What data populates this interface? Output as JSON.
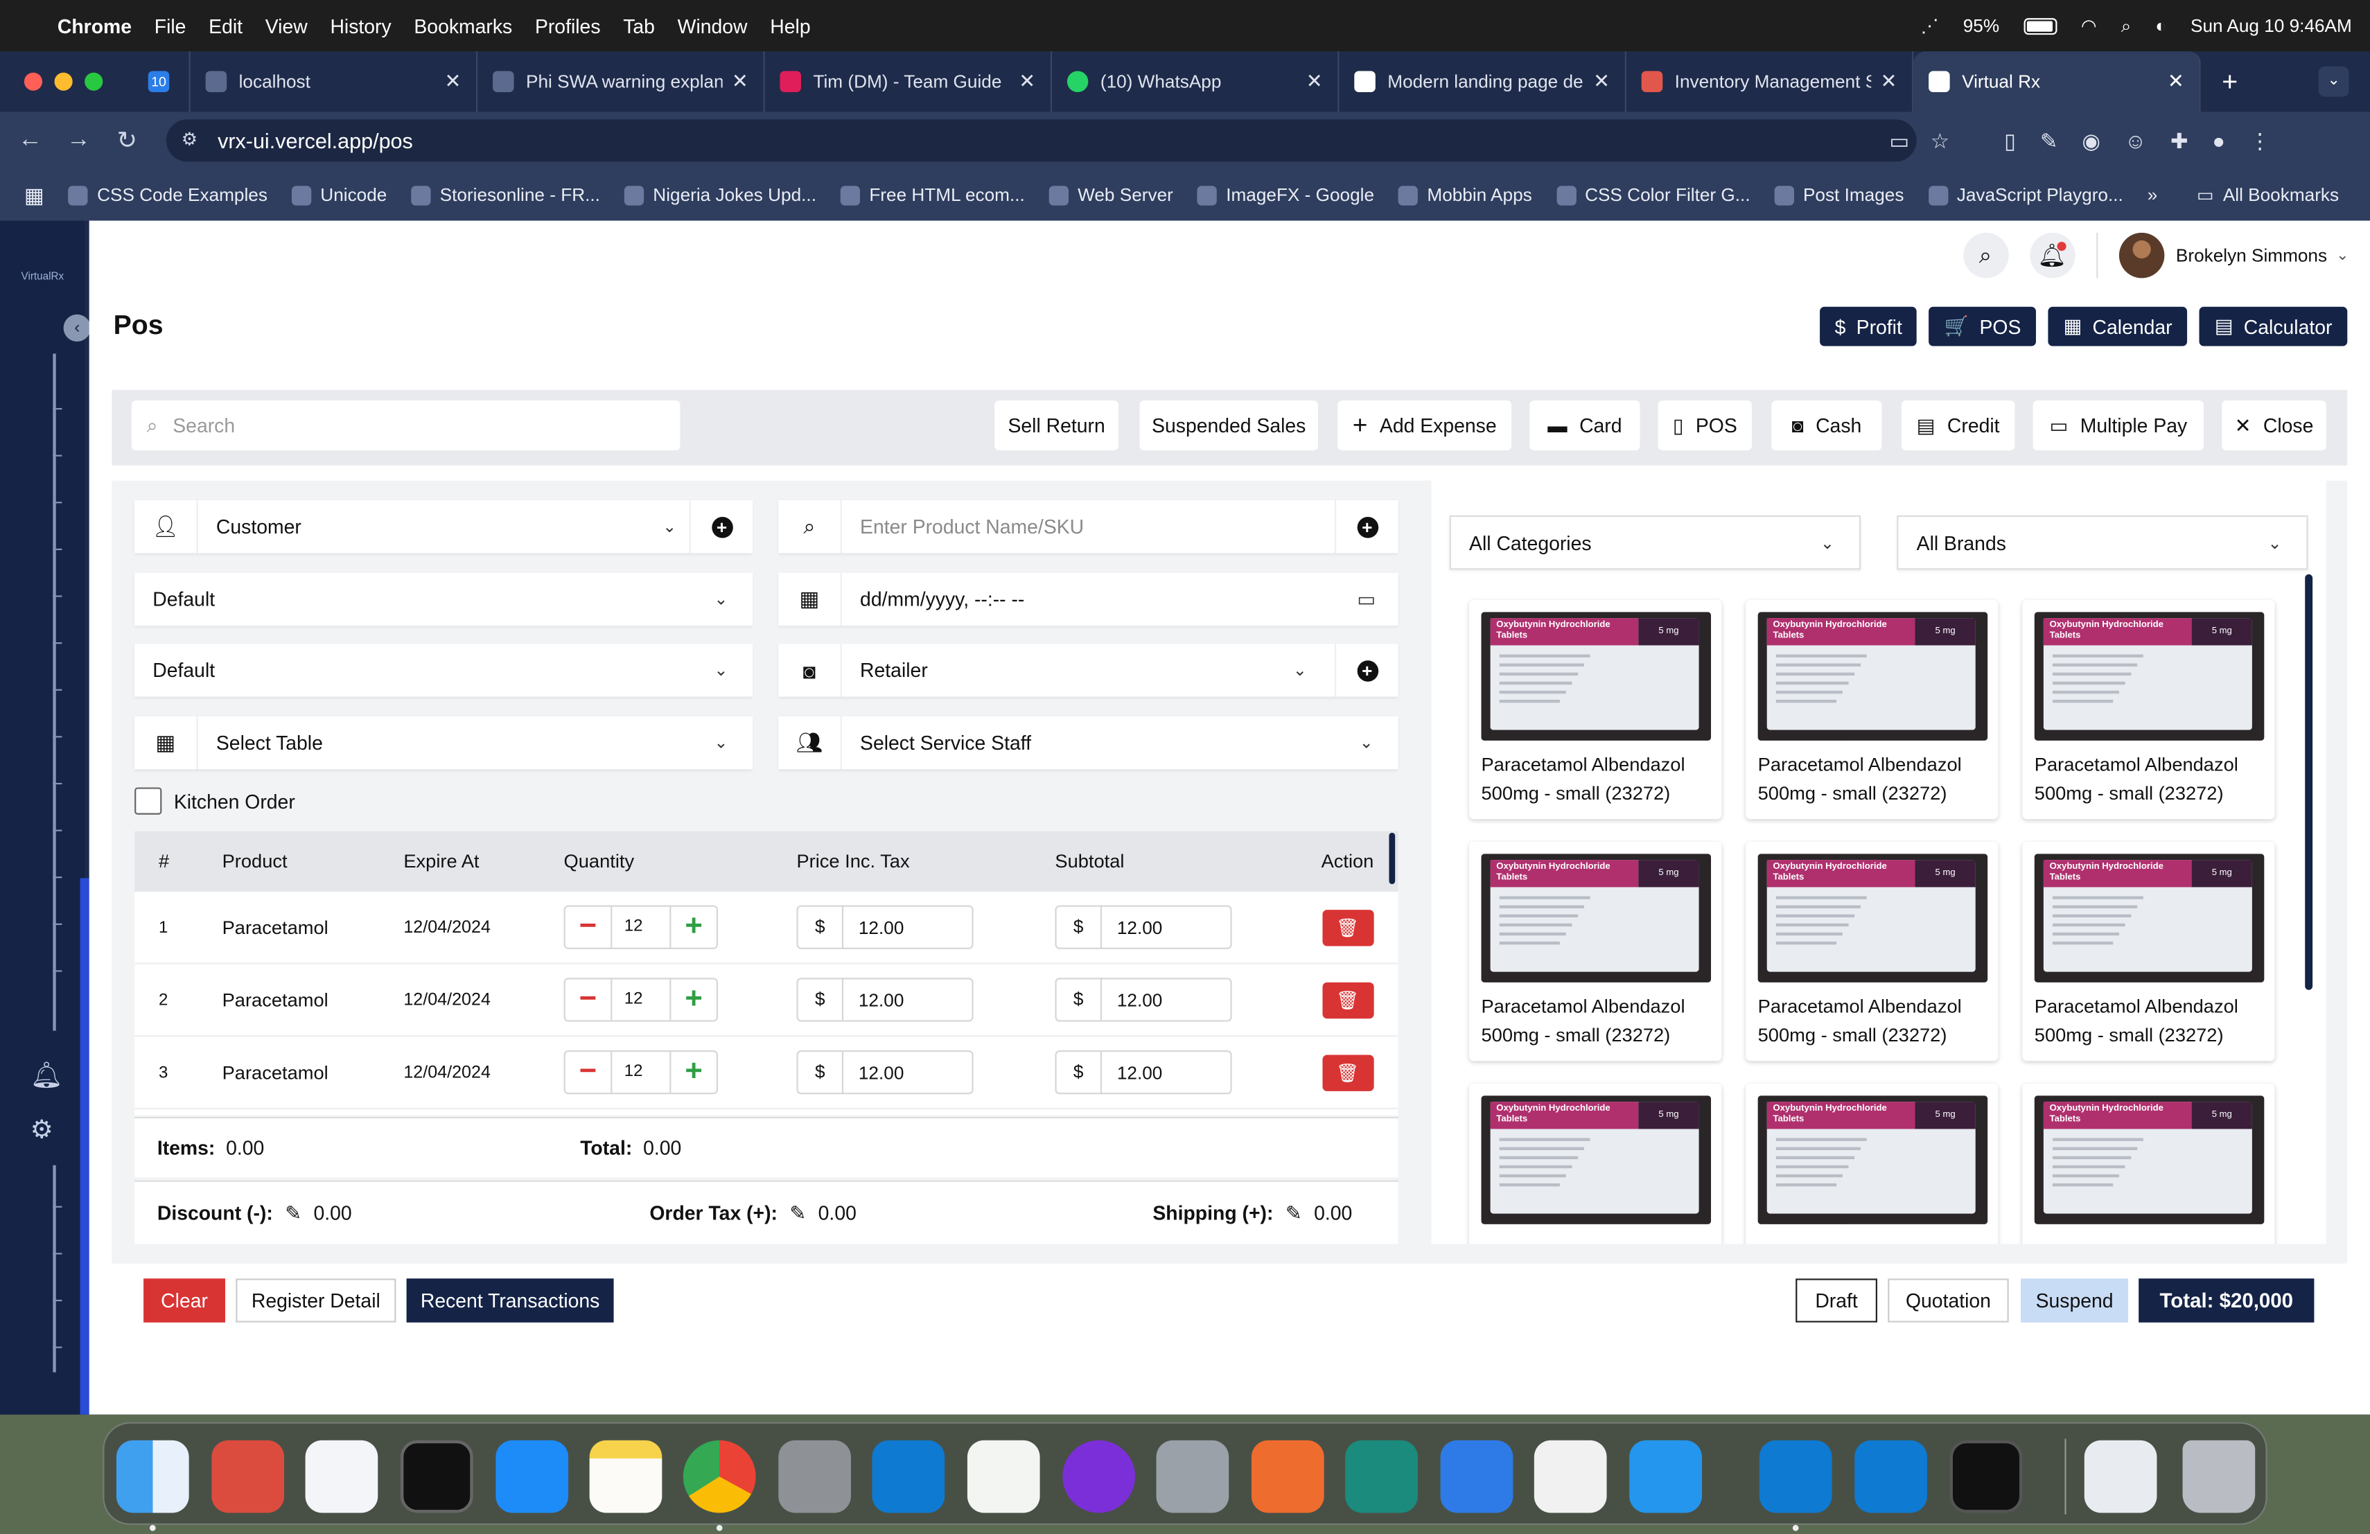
{
  "macos": {
    "app_name": "Chrome",
    "menus": [
      "File",
      "Edit",
      "View",
      "History",
      "Bookmarks",
      "Profiles",
      "Tab",
      "Window",
      "Help"
    ],
    "battery": "95%",
    "battery_level": 0.95,
    "datetime": "Sun Aug 10  9:46AM"
  },
  "browser": {
    "tabs": [
      {
        "title": "localhost",
        "active": false
      },
      {
        "title": "Phi SWA warning explan",
        "active": false
      },
      {
        "title": "Tim (DM) - Team Guide",
        "active": false
      },
      {
        "title": "(10) WhatsApp",
        "active": false
      },
      {
        "title": "Modern landing page de",
        "active": false
      },
      {
        "title": "Inventory Management S",
        "active": false
      },
      {
        "title": "Virtual Rx",
        "active": true
      }
    ],
    "first_tab_badge": "10",
    "url": "vrx-ui.vercel.app/pos",
    "bookmarks": [
      "CSS Code Examples",
      "Unicode",
      "Storiesonline - FR...",
      "Nigeria Jokes Upd...",
      "Free HTML ecom...",
      "Web Server",
      "ImageFX - Google",
      "Mobbin Apps",
      "CSS Color Filter G...",
      "Post Images",
      "JavaScript Playgro..."
    ],
    "bookmarks_overflow": "»",
    "all_bookmarks": "All Bookmarks"
  },
  "sidebar": {
    "logo_text": "VirtualRx"
  },
  "header": {
    "user_name": "Brokelyn Simmons"
  },
  "page": {
    "title": "Pos",
    "quick_buttons": [
      {
        "label": "Profit",
        "icon": "$"
      },
      {
        "label": "POS",
        "icon": "🛒"
      },
      {
        "label": "Calendar",
        "icon": "▦"
      },
      {
        "label": "Calculator",
        "icon": "▤"
      }
    ]
  },
  "actions": {
    "search_placeholder": "Search",
    "buttons": [
      {
        "label": "Sell Return",
        "icon": ""
      },
      {
        "label": "Suspended Sales",
        "icon": ""
      },
      {
        "label": "Add Expense",
        "icon": "+"
      },
      {
        "label": "Card",
        "icon": "▬"
      },
      {
        "label": "POS",
        "icon": "▯"
      },
      {
        "label": "Cash",
        "icon": "◙"
      },
      {
        "label": "Credit",
        "icon": "▤"
      },
      {
        "label": "Multiple Pay",
        "icon": "▭"
      },
      {
        "label": "Close",
        "icon": "✕"
      }
    ]
  },
  "form": {
    "customer": "Customer",
    "default_1": "Default",
    "default_2": "Default",
    "table": "Select Table",
    "product_placeholder": "Enter Product Name/SKU",
    "date_placeholder": "dd/mm/yyyy, --:-- --",
    "retailer": "Retailer",
    "service_staff": "Select Service Staff",
    "kitchen_order": "Kitchen Order"
  },
  "cart": {
    "headers": [
      "#",
      "Product",
      "Expire At",
      "Quantity",
      "Price Inc. Tax",
      "Subtotal",
      "Action"
    ],
    "currency": "$",
    "rows": [
      {
        "num": "1",
        "product": "Paracetamol",
        "expire": "12/04/2024",
        "qty": "12",
        "price": "12.00",
        "subtotal": "12.00"
      },
      {
        "num": "2",
        "product": "Paracetamol",
        "expire": "12/04/2024",
        "qty": "12",
        "price": "12.00",
        "subtotal": "12.00"
      },
      {
        "num": "3",
        "product": "Paracetamol",
        "expire": "12/04/2024",
        "qty": "12",
        "price": "12.00",
        "subtotal": "12.00"
      }
    ],
    "items_label": "Items:",
    "items_value": "0.00",
    "total_label": "Total:",
    "total_value": "0.00",
    "discount_label": "Discount (-):",
    "discount_value": "0.00",
    "order_tax_label": "Order Tax (+):",
    "order_tax_value": "0.00",
    "shipping_label": "Shipping (+):",
    "shipping_value": "0.00"
  },
  "products": {
    "category_filter": "All Categories",
    "brand_filter": "All Brands",
    "package_label": "Oxybutynin Hydrochloride Tablets",
    "package_strength": "5 mg",
    "items": [
      {
        "name": "Paracetamol Albendazol 500mg - small (23272)"
      },
      {
        "name": "Paracetamol Albendazol 500mg - small (23272)"
      },
      {
        "name": "Paracetamol Albendazol 500mg - small (23272)"
      },
      {
        "name": "Paracetamol Albendazol 500mg - small (23272)"
      },
      {
        "name": "Paracetamol Albendazol 500mg - small (23272)"
      },
      {
        "name": "Paracetamol Albendazol 500mg - small (23272)"
      },
      {
        "name": ""
      },
      {
        "name": ""
      },
      {
        "name": ""
      }
    ]
  },
  "footer": {
    "clear": "Clear",
    "register_detail": "Register Detail",
    "recent_transactions": "Recent Transactions",
    "draft": "Draft",
    "quotation": "Quotation",
    "suspend": "Suspend",
    "total": "Total: $20,000"
  },
  "colors": {
    "navy": "#142346",
    "danger": "#d93434",
    "suspend_bg": "#c9dcf5",
    "product_band": "#b0306e"
  }
}
